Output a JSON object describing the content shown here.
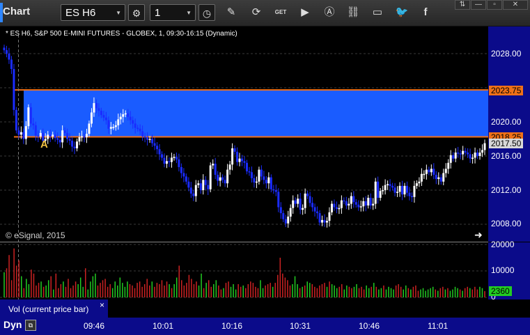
{
  "toolbar": {
    "app_title": "Chart",
    "symbol_value": "ES H6",
    "interval_value": "1",
    "icons": [
      "dropdown-arrow",
      "settings-gear-icon",
      "clock-icon",
      "pencil-draw-icon",
      "refresh-icon",
      "get-icon",
      "play-icon",
      "a-circle-icon",
      "link-icon",
      "comment-icon",
      "twitter-icon",
      "facebook-icon"
    ],
    "get_label": "GET",
    "window_buttons": [
      "⇅",
      "—",
      "▫",
      "✕"
    ]
  },
  "chart_header": "* ES H6, S&P 500 E-MINI FUTURES - GLOBEX, 1, 09:30-16:15 (Dynamic)",
  "copyright": "© eSignal, 2015",
  "annotation_label": "A",
  "price_axis": {
    "labels": [
      "2028.00",
      "2024.00",
      "2020.00",
      "2016.00",
      "2012.00",
      "2008.00"
    ],
    "tags": {
      "upper": {
        "text": "2023.75",
        "color": "#f07018"
      },
      "lower": {
        "text": "2018.25",
        "color": "#f07018"
      },
      "last": {
        "text": "2017.50",
        "color": "#d8d8d8"
      }
    }
  },
  "volume_axis": {
    "labels": [
      "20000",
      "10000",
      "0"
    ],
    "last_tag": {
      "text": "2360",
      "color": "#22cc22"
    }
  },
  "volume_legend": "Vol (current price bar)",
  "volume_legend_close": "×",
  "time_axis": [
    "09:46",
    "10:01",
    "10:16",
    "10:31",
    "10:46",
    "11:01"
  ],
  "status": {
    "mode": "Dyn"
  },
  "colors": {
    "background": "#000000",
    "axis_panel": "#0b0b8a",
    "zone": "#1a5cff",
    "zone_line": "#f07018",
    "up_candle": "#ffffff",
    "down_candle": "#1a2cff",
    "vol_up": "#22cc22",
    "vol_down": "#cc2222"
  },
  "chart_data": [
    {
      "type": "candlestick",
      "title": "* ES H6, S&P 500 E-MINI FUTURES - GLOBEX, 1, 09:30-16:15 (Dynamic)",
      "ylim": [
        2006,
        2030
      ],
      "y_ticks": [
        2028,
        2024,
        2020,
        2016,
        2012,
        2008
      ],
      "x_ticks": [
        "09:46",
        "10:01",
        "10:16",
        "10:31",
        "10:46",
        "11:01"
      ],
      "zone": {
        "from": 2018.25,
        "to": 2023.75
      },
      "closes": [
        2028.4,
        2028.0,
        2027.3,
        2026.2,
        2021.4,
        2019.0,
        2018.5,
        2018.8,
        2018.0,
        2019.5,
        2021.7,
        2019.8,
        2019.6,
        2018.4,
        2018.3,
        2018.7,
        2017.8,
        2018.0,
        2018.5,
        2018.3,
        2018.5,
        2018.1,
        2017.9,
        2017.6,
        2019.0,
        2018.7,
        2018.0,
        2017.8,
        2017.1,
        2016.9,
        2017.7,
        2018.2,
        2018.3,
        2018.2,
        2018.6,
        2019.8,
        2021.1,
        2022.2,
        2021.6,
        2021.3,
        2020.8,
        2020.5,
        2020.2,
        2019.2,
        2019.4,
        2019.4,
        2019.6,
        2020.3,
        2020.6,
        2020.9,
        2021.0,
        2020.6,
        2020.2,
        2019.8,
        2019.3,
        2019.2,
        2018.9,
        2018.3,
        2018.2,
        2017.9,
        2018.0,
        2017.5,
        2017.2,
        2016.8,
        2016.2,
        2015.8,
        2015.1,
        2015.4,
        2015.3,
        2015.8,
        2015.9,
        2015.6,
        2014.7,
        2014.0,
        2013.6,
        2013.0,
        2012.3,
        2011.6,
        2011.3,
        2012.6,
        2012.8,
        2012.0,
        2013.2,
        2012.6,
        2012.1,
        2014.9,
        2015.1,
        2013.8,
        2013.1,
        2013.5,
        2013.2,
        2012.8,
        2014.4,
        2015.0,
        2016.9,
        2016.5,
        2015.3,
        2015.7,
        2015.4,
        2015.2,
        2014.2,
        2014.1,
        2013.4,
        2012.9,
        2013.0,
        2014.4,
        2013.6,
        2013.2,
        2012.8,
        2013.5,
        2012.1,
        2012.0,
        2011.8,
        2010.0,
        2009.3,
        2008.6,
        2008.1,
        2008.9,
        2009.9,
        2010.8,
        2010.4,
        2011.0,
        2009.7,
        2009.9,
        2011.6,
        2011.3,
        2010.5,
        2010.0,
        2009.5,
        2009.3,
        2008.2,
        2008.5,
        2008.2,
        2008.4,
        2009.4,
        2010.4,
        2010.0,
        2009.8,
        2009.9,
        2010.8,
        2010.7,
        2010.2,
        2010.4,
        2011.3,
        2010.6,
        2010.3,
        2010.0,
        2010.1,
        2010.7,
        2010.2,
        2011.1,
        2010.2,
        2010.4,
        2013.0,
        2011.1,
        2011.9,
        2012.0,
        2012.6,
        2012.7,
        2012.5,
        2012.3,
        2011.7,
        2011.8,
        2012.5,
        2011.5,
        2012.5,
        2011.7,
        2011.3,
        2011.2,
        2012.5,
        2012.8,
        2013.0,
        2013.9,
        2013.9,
        2014.4,
        2014.1,
        2014.5,
        2013.8,
        2013.3,
        2013.5,
        2013.0,
        2014.0,
        2014.5,
        2015.2,
        2016.1,
        2015.7,
        2016.4,
        2016.3,
        2016.2,
        2016.6,
        2016.4,
        2016.2,
        2015.7,
        2015.8,
        2016.4,
        2016.0,
        2016.4,
        2016.7,
        2017.5
      ]
    },
    {
      "type": "bar",
      "title": "Vol (current price bar)",
      "ylim": [
        0,
        22000
      ],
      "y_ticks": [
        20000,
        10000,
        0
      ],
      "last_value": 2360,
      "values": [
        9500,
        11000,
        16000,
        6500,
        18500,
        12000,
        14000,
        8000,
        3500,
        7000,
        5000,
        10500,
        9000,
        4500,
        5500,
        6000,
        4000,
        4500,
        6500,
        8000,
        3000,
        9000,
        3500,
        5000,
        6000,
        4000,
        7000,
        3500,
        4500,
        6000,
        5000,
        7500,
        4000,
        11000,
        3000,
        6000,
        8000,
        9000,
        4500,
        5500,
        6500,
        7000,
        4000,
        5000,
        3500,
        6000,
        4500,
        7500,
        5500,
        4000,
        6000,
        5000,
        4500,
        3500,
        5500,
        6000,
        4000,
        5000,
        7000,
        4500,
        6000,
        4000,
        5500,
        5000,
        6500,
        4500,
        6000,
        5000,
        3500,
        5000,
        7500,
        12000,
        6500,
        4500,
        5500,
        8500,
        7000,
        5000,
        6000,
        4500,
        9000,
        3500,
        5500,
        6500,
        4000,
        5000,
        6500,
        4500,
        3000,
        3500,
        5500,
        6000,
        4000,
        5000,
        3000,
        5000,
        4000,
        4500,
        3500,
        5000,
        6000,
        5500,
        4000,
        3500,
        6500,
        3500,
        4500,
        5000,
        5500,
        4000,
        5500,
        8500,
        15000,
        9000,
        7500,
        6500,
        4500,
        5000,
        8000,
        5000,
        3500,
        4000,
        4500,
        6000,
        5500,
        5000,
        4000,
        3500,
        4500,
        5000,
        5500,
        4000,
        6000,
        5000,
        4500,
        3500,
        4000,
        5000,
        3000,
        4500,
        4000,
        3500,
        4000,
        5000,
        3500,
        4000,
        3000,
        4500,
        3500,
        4000,
        5500,
        4000,
        3000,
        3500,
        4500,
        3000,
        4000,
        3500,
        3000,
        4500,
        5000,
        4000,
        3000,
        4500,
        3500,
        3000,
        4000,
        4500,
        2500,
        3000,
        3500,
        2500,
        3000,
        3500,
        4000,
        3000,
        2500,
        3500,
        4000,
        3000,
        3500,
        2500,
        3000,
        4000,
        3500,
        3000,
        2500,
        3500,
        4000,
        3500,
        3000,
        4000,
        3000,
        4000,
        3500,
        2360
      ]
    }
  ]
}
